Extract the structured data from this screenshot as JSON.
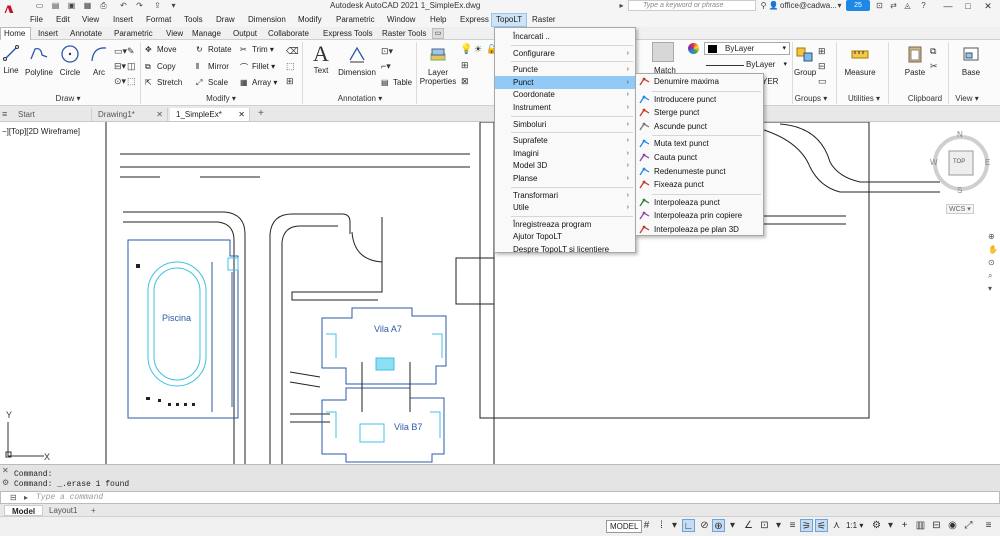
{
  "app": {
    "title": "Autodesk AutoCAD 2021    1_SimpleEx.dwg",
    "logo": "A",
    "search_placeholder": "Type a keyword or phrase",
    "user": "office@cadwa...",
    "badge": "25",
    "window_controls": [
      "—",
      "□",
      "✕"
    ]
  },
  "menubar": [
    "File",
    "Edit",
    "View",
    "Insert",
    "Format",
    "Tools",
    "Draw",
    "Dimension",
    "Modify",
    "Parametric",
    "Window",
    "Help",
    "Express",
    "TopoLT",
    "Raster"
  ],
  "ribbon_tabs": [
    "Home",
    "Insert",
    "Annotate",
    "Parametric",
    "View",
    "Manage",
    "Output",
    "Collaborate",
    "Express Tools",
    "Raster Tools"
  ],
  "ribbon": {
    "draw": {
      "title": "Draw ▾",
      "tools": [
        "Line",
        "Polyline",
        "Circle",
        "Arc"
      ]
    },
    "modify": {
      "title": "Modify ▾",
      "tools": [
        "Move",
        "Rotate",
        "Trim ▾",
        "Copy",
        "Mirror",
        "Fillet ▾",
        "Stretch",
        "Scale",
        "Array ▾"
      ]
    },
    "annotation": {
      "title": "Annotation ▾",
      "tools": [
        "Text",
        "Dimension",
        "Table"
      ]
    },
    "layers": {
      "tools": [
        "Layer Properties"
      ]
    },
    "properties": {
      "bylayer_1": "ByLayer",
      "bylayer_2": "ByLayer",
      "layer_frag": "YER"
    },
    "groups": {
      "title": "Groups ▾",
      "tools": [
        "Group"
      ]
    },
    "utilities": {
      "title": "Utilities ▾",
      "tools": [
        "Measure"
      ]
    },
    "clipboard": {
      "title": "Clipboard",
      "tools": [
        "Paste"
      ]
    },
    "view": {
      "title": "View ▾",
      "tools": [
        "Base"
      ]
    },
    "partial_label": "Match"
  },
  "doc_tabs": [
    "Start",
    "Drawing1*",
    "1_SimpleEx*"
  ],
  "viewport_label": "−][Top][2D Wireframe]",
  "viewcube": {
    "n": "N",
    "s": "S",
    "e": "E",
    "w": "W",
    "top": "TOP",
    "wcs": "WCS ▾"
  },
  "drawing_labels": {
    "pool": "Piscina",
    "villa_a": "Vila A7",
    "villa_b": "Vila B7",
    "axis_y": "Y",
    "axis_x": "X"
  },
  "command": {
    "history": [
      "Command:",
      "Command: _.erase 1 found"
    ],
    "placeholder": "Type a command",
    "prompt_icon": "▸"
  },
  "layout_tabs": [
    "Model",
    "Layout1",
    "+"
  ],
  "status": {
    "model": "MODEL",
    "scale": "1:1 ▾"
  },
  "topolt_menu": [
    {
      "label": "Încarcati ..",
      "arrow": false
    },
    {
      "sep": true
    },
    {
      "label": "Configurare",
      "arrow": true
    },
    {
      "sep": true
    },
    {
      "label": "Puncte",
      "arrow": true
    },
    {
      "label": "Punct",
      "arrow": true,
      "highlight": true
    },
    {
      "label": "Coordonate",
      "arrow": true
    },
    {
      "label": "Instrument",
      "arrow": true
    },
    {
      "sep": true
    },
    {
      "label": "Simboluri",
      "arrow": true
    },
    {
      "sep": true
    },
    {
      "label": "Suprafete",
      "arrow": true
    },
    {
      "label": "Imagini",
      "arrow": true
    },
    {
      "label": "Model 3D",
      "arrow": true
    },
    {
      "label": "Planse",
      "arrow": true
    },
    {
      "sep": true
    },
    {
      "label": "Transformari",
      "arrow": true
    },
    {
      "label": "Utile",
      "arrow": true
    },
    {
      "sep": true
    },
    {
      "label": "Înregistreaza program",
      "arrow": false
    },
    {
      "label": "Ajutor TopoLT",
      "arrow": false
    },
    {
      "label": "Despre TopoLT si licentiere",
      "arrow": false
    }
  ],
  "punct_menu": [
    {
      "label": "Denumire maxima",
      "icon": "max-name-icon"
    },
    {
      "sep": true
    },
    {
      "label": "Introducere punct",
      "icon": "insert-point-icon"
    },
    {
      "label": "Sterge punct",
      "icon": "delete-point-icon"
    },
    {
      "label": "Ascunde punct",
      "icon": "hide-point-icon"
    },
    {
      "sep": true
    },
    {
      "label": "Muta text punct",
      "icon": "move-text-icon"
    },
    {
      "label": "Cauta punct",
      "icon": "find-point-icon"
    },
    {
      "label": "Redenumeste punct",
      "icon": "rename-point-icon"
    },
    {
      "label": "Fixeaza punct",
      "icon": "fix-point-icon"
    },
    {
      "sep": true
    },
    {
      "label": "Interpoleaza punct",
      "icon": "interpolate-icon"
    },
    {
      "label": "Interpoleaza prin copiere",
      "icon": "interpolate-copy-icon"
    },
    {
      "label": "Interpoleaza pe plan 3D",
      "icon": "interpolate-3d-icon"
    }
  ],
  "colors": {
    "accent": "#1e88e5",
    "highlight": "#91c9f7",
    "drawing_line": "#222222",
    "drawing_blue": "#2b5aa8",
    "drawing_cyan": "#3fc1e6"
  }
}
